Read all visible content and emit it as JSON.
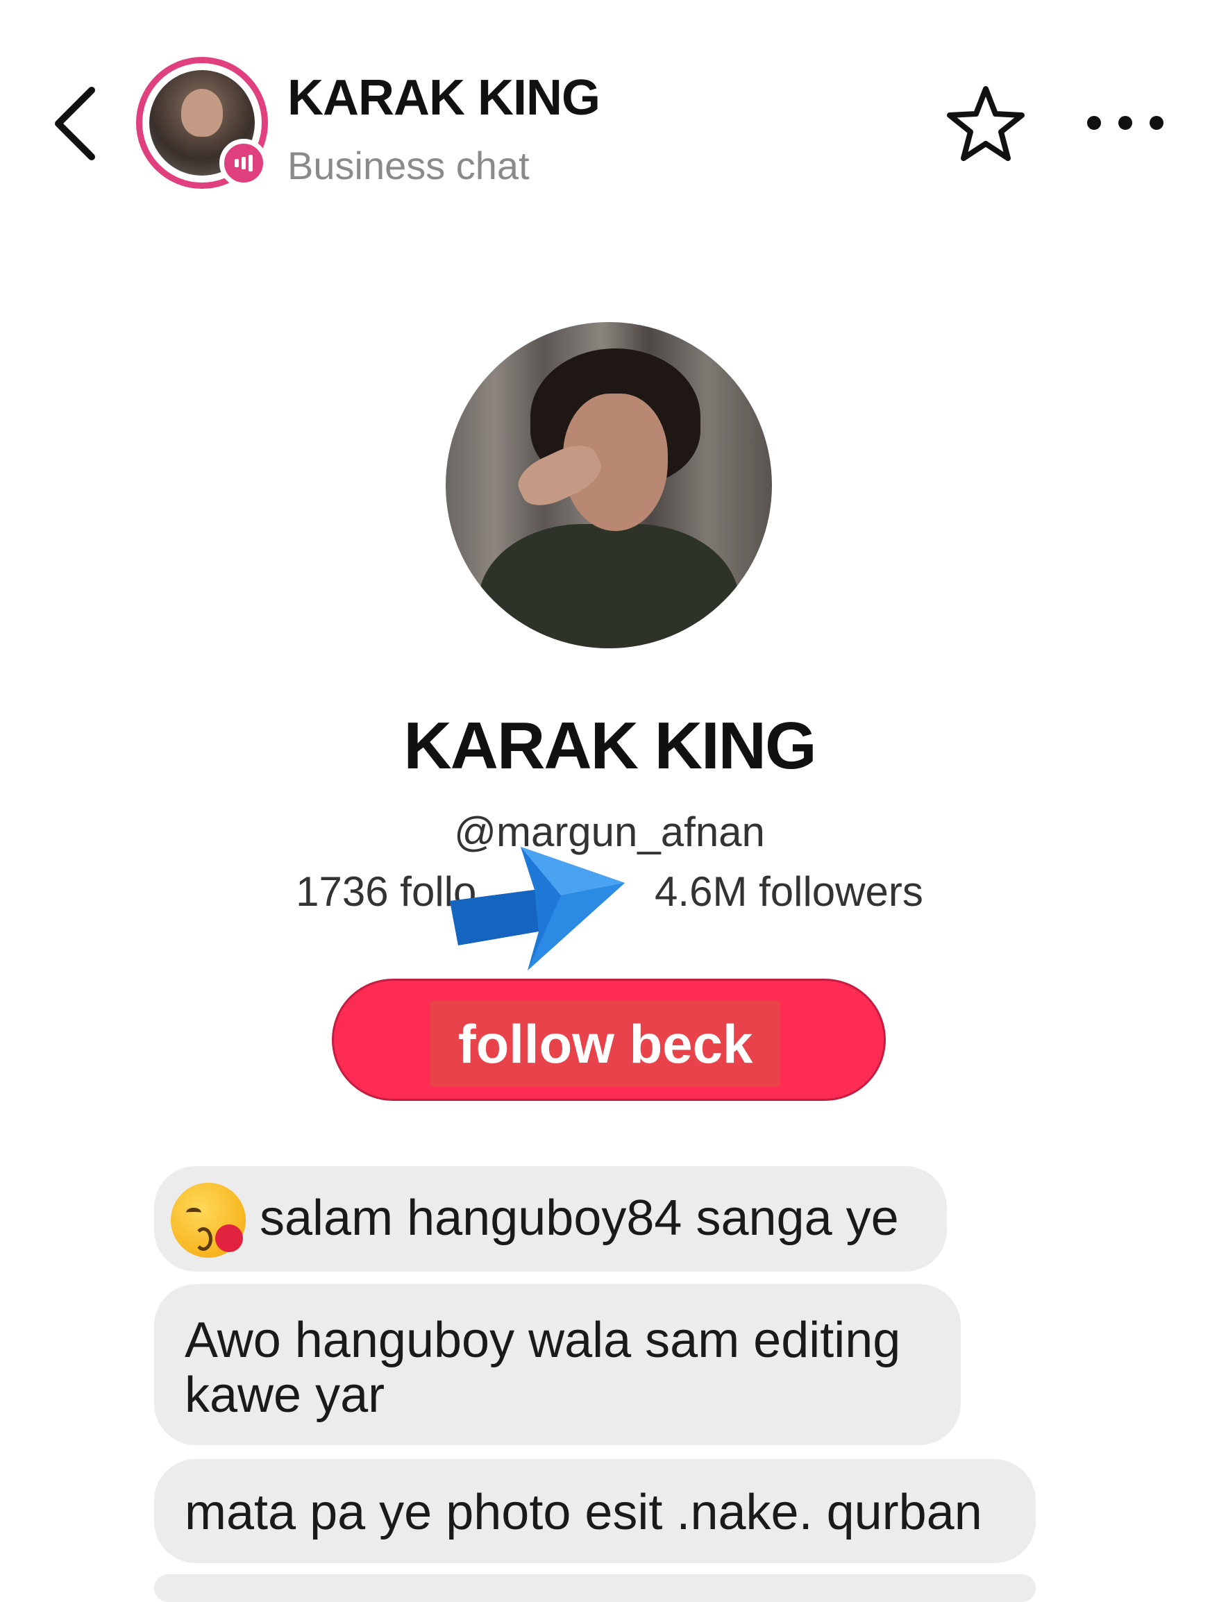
{
  "header": {
    "title": "KARAK KING",
    "subtitle": "Business chat"
  },
  "profile": {
    "name": "KARAK KING",
    "handle": "@margun_afnan",
    "following_count": "1736",
    "following_label": "follo",
    "followers": "4.6M followers"
  },
  "actions": {
    "follow_label": "follow beck"
  },
  "messages": [
    {
      "text": "salam hanguboy84 sanga ye",
      "emoji": "kissing-face-with-heart-emoji"
    },
    {
      "text": "Awo hanguboy wala sam editing kawe yar"
    },
    {
      "text": "mata pa ye photo esit .nake. qurban"
    }
  ],
  "colors": {
    "accent": "#fe2c55",
    "ring": "#e0407e",
    "bubble": "#ececec",
    "arrow": "#1e78d6"
  },
  "icons": {
    "back": "chevron-left-icon",
    "star": "star-outline-icon",
    "more": "more-horizontal-icon",
    "overlay": "blue-arrow-icon"
  }
}
